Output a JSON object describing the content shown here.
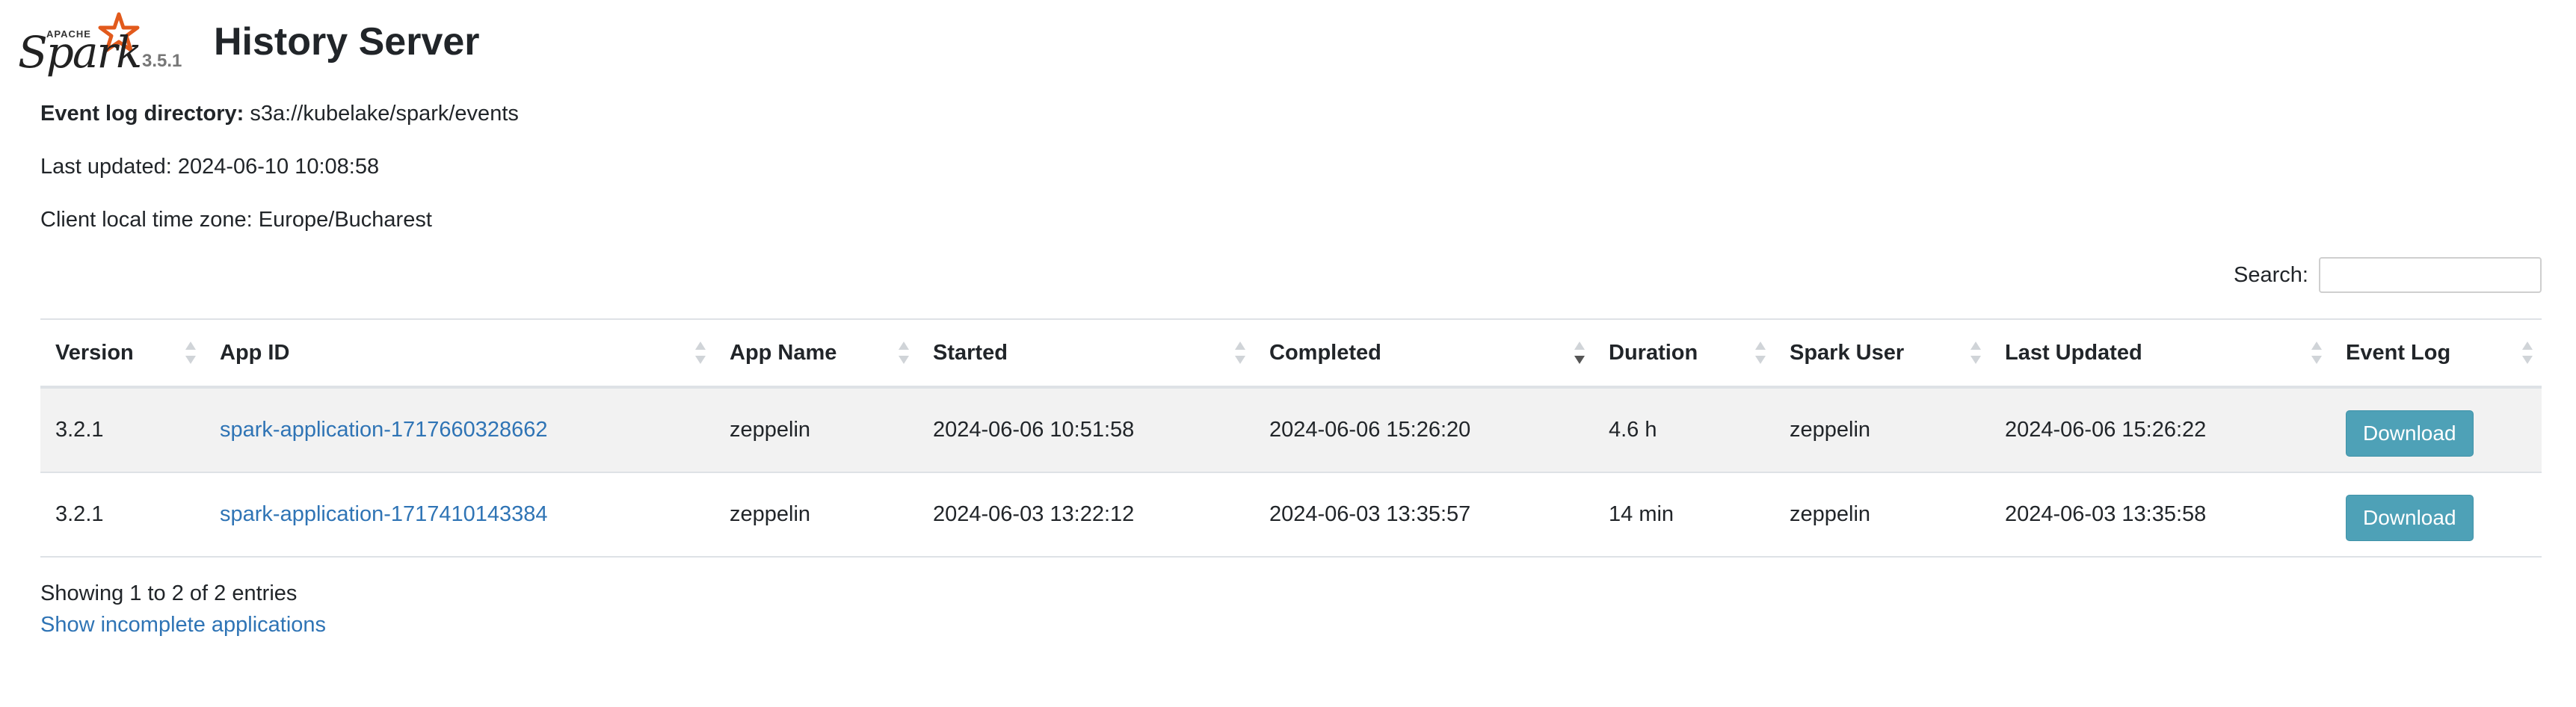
{
  "header": {
    "logo_small_text": "APACHE",
    "logo_text": "Spark",
    "version": "3.5.1",
    "title": "History Server"
  },
  "info": {
    "event_log_label": "Event log directory:",
    "event_log_value": "s3a://kubelake/spark/events",
    "last_updated": "Last updated: 2024-06-10 10:08:58",
    "timezone": "Client local time zone: Europe/Bucharest"
  },
  "search": {
    "label": "Search:",
    "value": "",
    "placeholder": ""
  },
  "table": {
    "columns": [
      "Version",
      "App ID",
      "App Name",
      "Started",
      "Completed",
      "Duration",
      "Spark User",
      "Last Updated",
      "Event Log"
    ],
    "sorted_column": "Completed",
    "sort_direction": "descending",
    "rows": [
      {
        "version": "3.2.1",
        "app_id": "spark-application-1717660328662",
        "app_name": "zeppelin",
        "started": "2024-06-06 10:51:58",
        "completed": "2024-06-06 15:26:20",
        "duration": "4.6 h",
        "spark_user": "zeppelin",
        "last_updated": "2024-06-06 15:26:22",
        "event_log": "Download"
      },
      {
        "version": "3.2.1",
        "app_id": "spark-application-1717410143384",
        "app_name": "zeppelin",
        "started": "2024-06-03 13:22:12",
        "completed": "2024-06-03 13:35:57",
        "duration": "14 min",
        "spark_user": "zeppelin",
        "last_updated": "2024-06-03 13:35:58",
        "event_log": "Download"
      }
    ]
  },
  "footer": {
    "showing": "Showing 1 to 2 of 2 entries",
    "incomplete_link": "Show incomplete applications"
  },
  "colors": {
    "link": "#2f74b5",
    "button": "#4ea1b7",
    "spark_star": "#e25a1c",
    "striped_row": "#f2f2f2"
  }
}
